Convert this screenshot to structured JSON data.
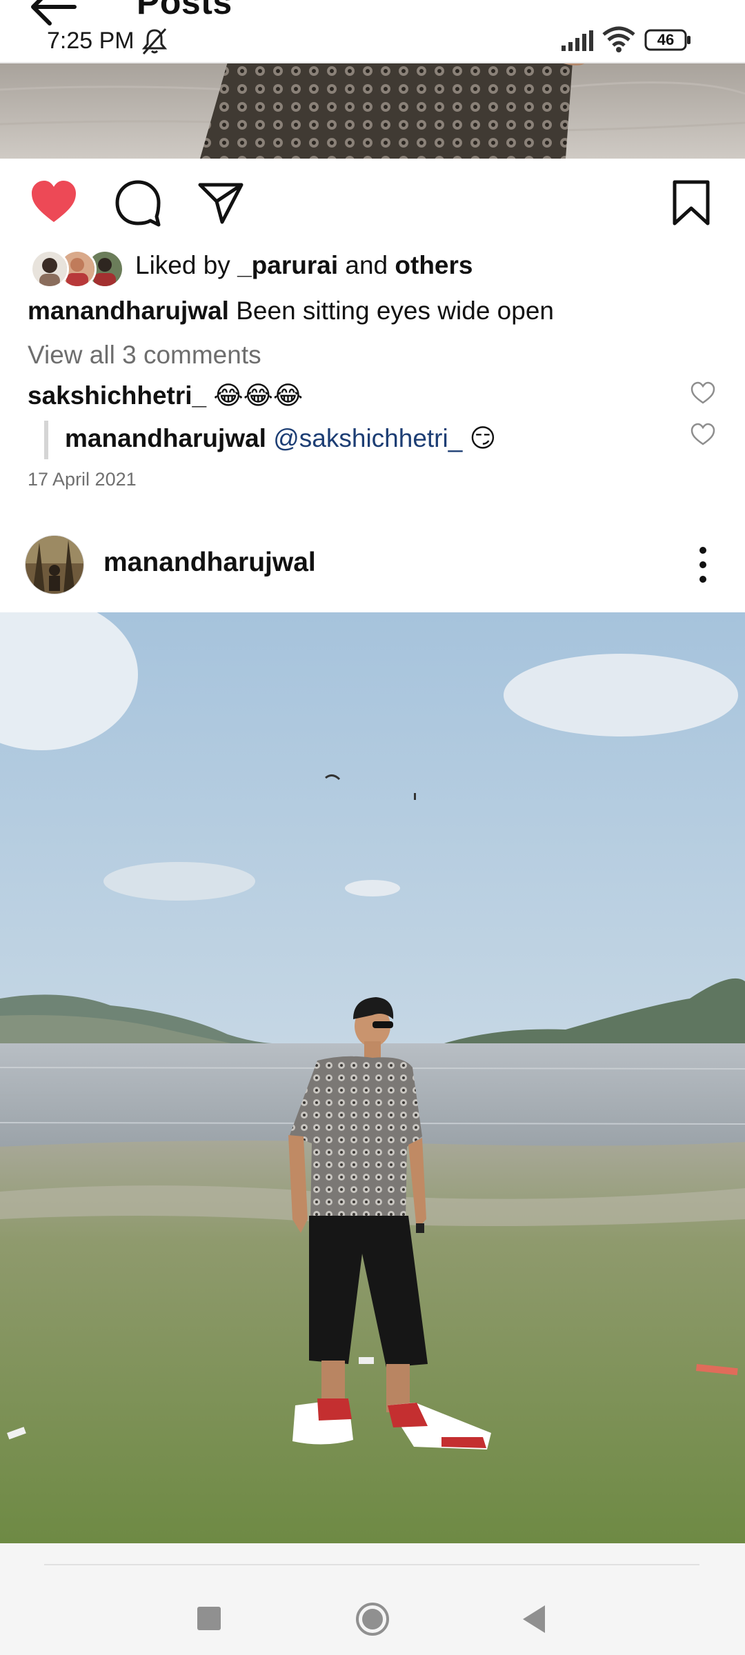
{
  "header": {
    "title": "Posts",
    "back_icon": "arrow-left-icon"
  },
  "status_bar": {
    "time": "7:25 PM",
    "battery": "46",
    "icons": [
      "mute-icon",
      "signal-icon",
      "wifi-icon",
      "battery-icon"
    ]
  },
  "post": {
    "liked_by_prefix": "Liked by ",
    "liked_by_user": "_parurai",
    "liked_by_middle": " and ",
    "liked_by_others": "others",
    "caption_user": "manandharujwal",
    "caption_text": " Been sitting eyes wide open",
    "view_comments": "View all 3 comments",
    "comments": [
      {
        "user": "sakshichhetri_",
        "text": " 😂😂😂"
      },
      {
        "user": "manandharujwal",
        "mention": " @sakshichhetri_",
        "text": " 😏"
      }
    ],
    "date": "17 April 2021"
  },
  "next_post": {
    "username": "manandharujwal"
  },
  "colors": {
    "like": "#ed4956",
    "mention": "#1d3e74",
    "muted_text": "#6e6e6e"
  }
}
